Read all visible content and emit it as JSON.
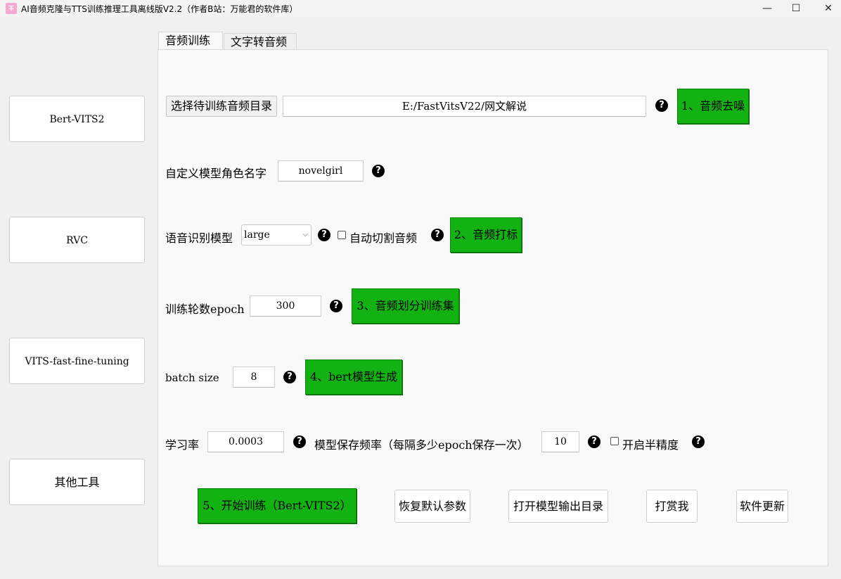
{
  "window": {
    "title": "AI音频克隆与TTS训练推理工具离线版V2.2（作者B站：万能君的软件库）",
    "icon_text": "∓",
    "minimize": "—",
    "maximize": "☐",
    "close": "✕"
  },
  "sidebar": {
    "items": [
      {
        "label": "Bert-VITS2"
      },
      {
        "label": "RVC"
      },
      {
        "label": "VITS-fast-fine-tuning"
      },
      {
        "label": "其他工具"
      }
    ]
  },
  "tabs": [
    {
      "label": "音频训练",
      "active": true
    },
    {
      "label": "文字转音频",
      "active": false
    }
  ],
  "form": {
    "dir_button": "选择待训练音频目录",
    "dir_value": "E:/FastVitsV22/网文解说",
    "denoise_button": "1、音频去噪",
    "role_label": "自定义模型角色名字",
    "role_value": "novelgirl",
    "asr_label": "语音识别模型",
    "asr_value": "large",
    "auto_split_label": "自动切割音频",
    "label_button": "2、音频打标",
    "epoch_label": "训练轮数epoch",
    "epoch_value": "300",
    "split_button": "3、音频划分训练集",
    "batch_label": "batch size",
    "batch_value": "8",
    "bert_button": "4、bert模型生成",
    "lr_label": "学习率",
    "lr_value": "0.0003",
    "save_freq_label": "模型保存频率（每隔多少epoch保存一次）",
    "save_freq_value": "10",
    "half_precision_label": "开启半精度",
    "help_icon": "?"
  },
  "actions": {
    "train": "5、开始训练（Bert-VITS2）",
    "reset": "恢复默认参数",
    "open_output": "打开模型输出目录",
    "donate": "打赏我",
    "update": "软件更新"
  },
  "colors": {
    "green": "#11b211",
    "background": "#f0f0f0",
    "panel": "#f9f9f9"
  }
}
